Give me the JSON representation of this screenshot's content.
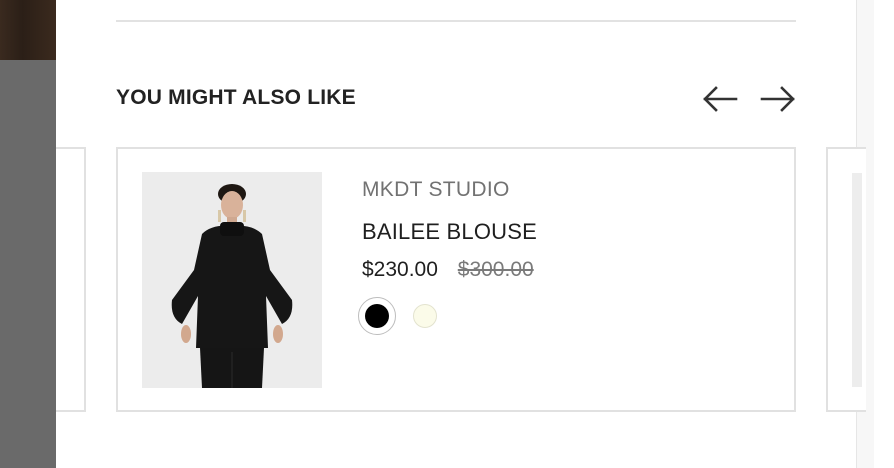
{
  "section": {
    "title": "YOU MIGHT ALSO LIKE",
    "prev_icon": "arrow-left-icon",
    "next_icon": "arrow-right-icon"
  },
  "product": {
    "brand": "MKDT STUDIO",
    "name": "BAILEE BLOUSE",
    "price": "$230.00",
    "original_price": "$300.00",
    "swatches": [
      {
        "color": "#000000",
        "selected": true
      },
      {
        "color": "#fbfbe9",
        "selected": false
      }
    ]
  },
  "colors": {
    "overlay": "#6a6a6a",
    "border": "#e1e1e1",
    "text": "#222222",
    "muted": "#727272"
  }
}
